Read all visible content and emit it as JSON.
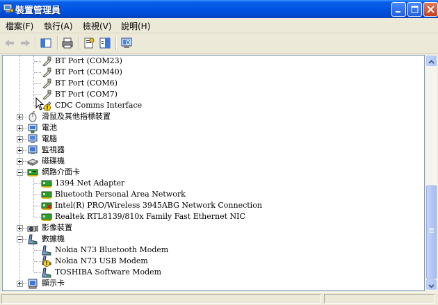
{
  "window": {
    "title": "裝置管理員"
  },
  "menu": {
    "file": "檔案(F)",
    "action": "執行(A)",
    "view": "檢視(V)",
    "help": "說明(H)"
  },
  "tree": {
    "ports": [
      {
        "label": "BT Port (COM23)"
      },
      {
        "label": "BT Port (COM40)"
      },
      {
        "label": "BT Port (COM6)"
      },
      {
        "label": "BT Port (COM7)"
      },
      {
        "label": "CDC Comms Interface",
        "warning": true
      }
    ],
    "mouse": "滑鼠及其他指標裝置",
    "battery": "電池",
    "computer": "電腦",
    "monitor": "監視器",
    "disk": "磁碟機",
    "network": {
      "label": "網路介面卡",
      "items": [
        {
          "label": "1394 Net Adapter"
        },
        {
          "label": "Bluetooth Personal Area Network"
        },
        {
          "label": "Intel(R) PRO/Wireless 3945ABG Network Connection"
        },
        {
          "label": "Realtek RTL8139/810x Family Fast Ethernet NIC"
        }
      ]
    },
    "imaging": "影像裝置",
    "modem": {
      "label": "數據機",
      "items": [
        {
          "label": "Nokia N73 Bluetooth Modem"
        },
        {
          "label": "Nokia N73 USB Modem",
          "warning": true
        },
        {
          "label": "TOSHIBA Software Modem"
        }
      ]
    },
    "display": "顯示卡"
  },
  "colors": {
    "titlebar": "#0054E3",
    "warning": "#FFD800",
    "nic_green": "#2E9E2E"
  }
}
